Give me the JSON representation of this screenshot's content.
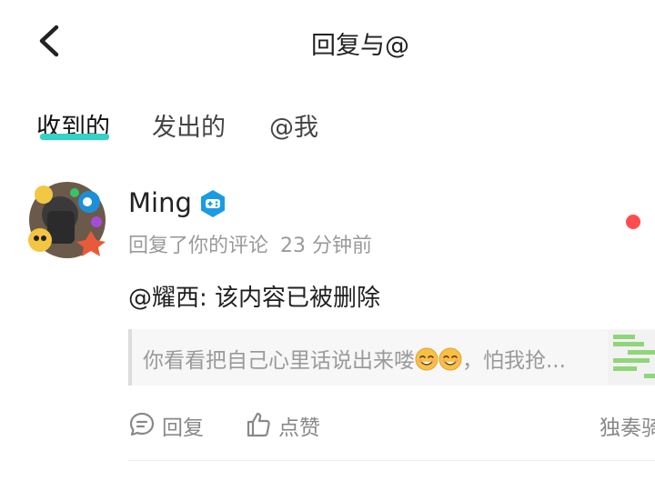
{
  "header": {
    "title": "回复与@"
  },
  "tabs": [
    {
      "label": "收到的"
    },
    {
      "label": "发出的"
    },
    {
      "label": "@我"
    }
  ],
  "notification": {
    "username": "Ming",
    "action_text": "回复了你的评论",
    "time": "23 分钟前",
    "content": "@耀西: 该内容已被删除",
    "quoted_comment": "你看看把自己心里话说出来喽",
    "quoted_comment_suffix": "，怕我抢...",
    "actions": {
      "reply_label": "回复",
      "like_label": "点赞"
    },
    "source_label": "独奏骑"
  },
  "colors": {
    "tab_underline": "#33d2c6",
    "unread_dot": "#ff4d4f",
    "badge": "#1a9be6",
    "secondary_text": "#9a9a9a"
  },
  "icons": {
    "back": "chevron-left-icon",
    "badge": "gamepad-badge-icon",
    "reply": "comment-bubble-icon",
    "like": "thumbs-up-icon",
    "emoji": "smile-emoji-icon"
  }
}
